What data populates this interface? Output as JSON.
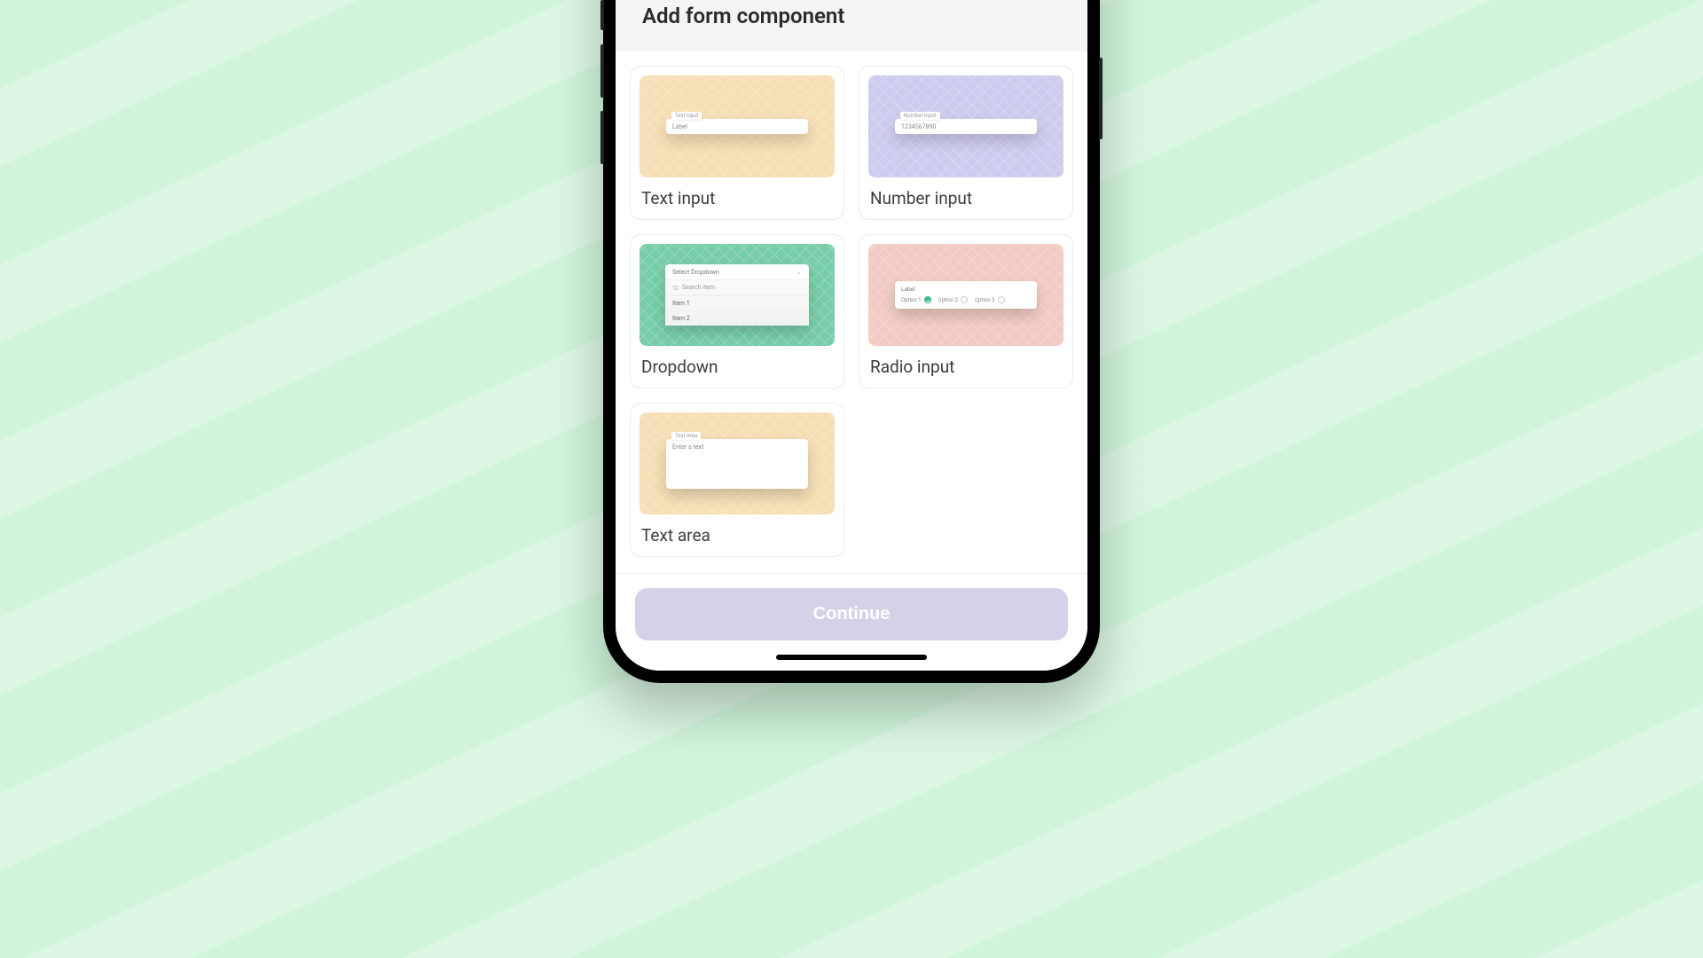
{
  "header": {
    "title": "Add form component"
  },
  "components": {
    "text_input": {
      "title": "Text input",
      "preview_label": "Text Input",
      "preview_value": "Label"
    },
    "number_input": {
      "title": "Number input",
      "preview_label": "Number Input",
      "preview_value": "1234567890"
    },
    "dropdown": {
      "title": "Dropdown",
      "placeholder": "Select Dropdown",
      "search_placeholder": "Search item",
      "items": [
        "Item 1",
        "Item 2"
      ]
    },
    "radio": {
      "title": "Radio input",
      "preview_label": "Label",
      "options": [
        "Option 1",
        "Option 2",
        "Option 3"
      ],
      "selected_index": 0
    },
    "text_area": {
      "title": "Text area",
      "preview_label": "Text Area",
      "preview_placeholder": "Enter a text"
    }
  },
  "footer": {
    "continue_label": "Continue"
  },
  "colors": {
    "bg_mint": "#d0f5db",
    "card_orange": "#f6dfb4",
    "card_purple": "#cdccee",
    "card_green": "#77ceab",
    "card_pink": "#f3cbc4",
    "button_disabled": "#d6d1e8"
  }
}
